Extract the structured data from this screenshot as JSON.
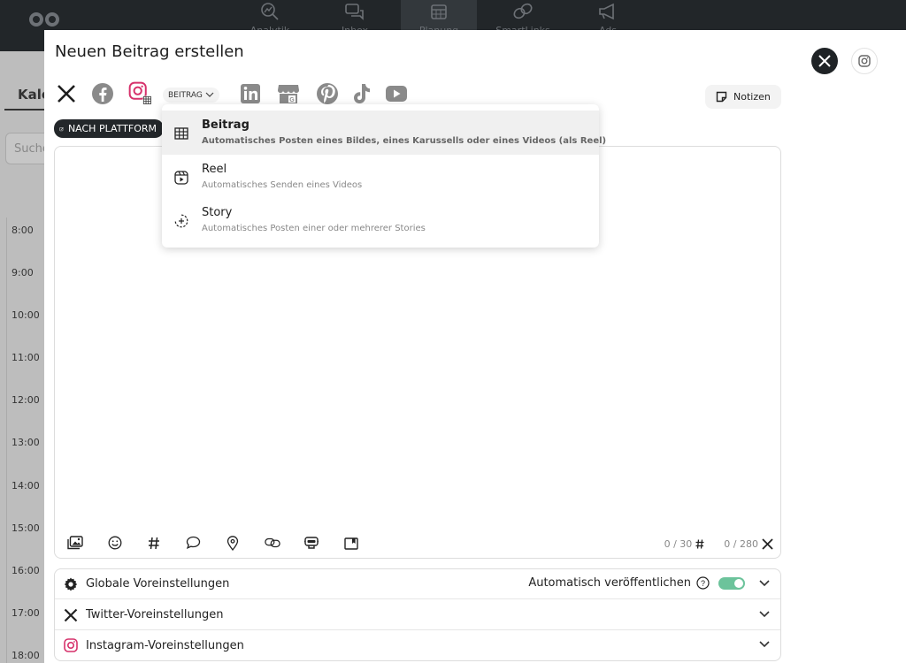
{
  "nav": {
    "items": [
      {
        "label": "Analytik",
        "icon": "analytics-icon"
      },
      {
        "label": "Inbox",
        "icon": "inbox-icon"
      },
      {
        "label": "Planung",
        "icon": "calendar-icon"
      },
      {
        "label": "SmartLinks",
        "icon": "link-icon"
      },
      {
        "label": "Ads",
        "icon": "megaphone-icon"
      }
    ],
    "active": "Planung"
  },
  "background": {
    "tab": "Kale",
    "search_placeholder": "Suche",
    "hours": [
      "8:00",
      "9:00",
      "10:00",
      "11:00",
      "12:00",
      "13:00",
      "14:00",
      "15:00",
      "16:00",
      "17:00",
      "18:00"
    ]
  },
  "modal": {
    "title": "Neuen Beitrag erstellen",
    "format_chip": "BEITRAG",
    "notes_label": "Notizen",
    "per_platform_label": "NACH PLATTFORM",
    "counters": {
      "hashtags": "0 / 30",
      "chars": "0 / 280"
    }
  },
  "dropdown": {
    "options": [
      {
        "title": "Beitrag",
        "desc": "Automatisches Posten eines Bildes, eines Karussells oder eines Videos (als Reel)",
        "selected": true
      },
      {
        "title": "Reel",
        "desc": "Automatisches Senden eines Videos",
        "selected": false
      },
      {
        "title": "Story",
        "desc": "Automatisches Posten einer oder mehrerer Stories",
        "selected": false
      }
    ]
  },
  "settings": {
    "global": "Globale Voreinstellungen",
    "auto_publish": "Automatisch veröffentlichen",
    "auto_publish_on": true,
    "twitter": "Twitter-Voreinstellungen",
    "instagram": "Instagram-Voreinstellungen"
  },
  "colors": {
    "instagram": "#d6316b",
    "toggle": "#6cc39b",
    "nav_bg": "#222629"
  }
}
